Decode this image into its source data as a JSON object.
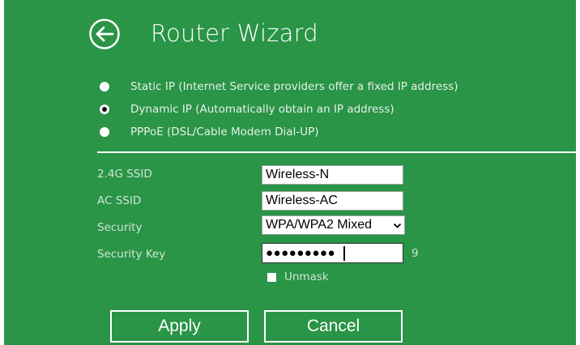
{
  "header": {
    "title": "Router Wizard",
    "back_icon": "arrow-left-circle-icon"
  },
  "connection_type": {
    "selected": "dynamic",
    "options": [
      {
        "id": "static",
        "label": "Static IP (Internet Service providers offer a fixed IP address)"
      },
      {
        "id": "dynamic",
        "label": "Dynamic IP (Automatically obtain an IP address)"
      },
      {
        "id": "pppoe",
        "label": "PPPoE (DSL/Cable Modem Dial-UP)"
      }
    ]
  },
  "form": {
    "ssid_24g_label": "2.4G SSID",
    "ssid_24g_value": "Wireless-N",
    "ac_ssid_label": "AC SSID",
    "ac_ssid_value": "Wireless-AC",
    "security_label": "Security",
    "security_value": "WPA/WPA2  Mixed",
    "security_key_label": "Security Key",
    "security_key_masked": "●●●●●●●●●",
    "security_key_length": "9",
    "unmask_label": "Unmask",
    "unmask_checked": false
  },
  "buttons": {
    "apply": "Apply",
    "cancel": "Cancel"
  },
  "colors": {
    "background": "#2a9447",
    "text": "#ffffff",
    "muted_text": "#cfe6d4"
  }
}
